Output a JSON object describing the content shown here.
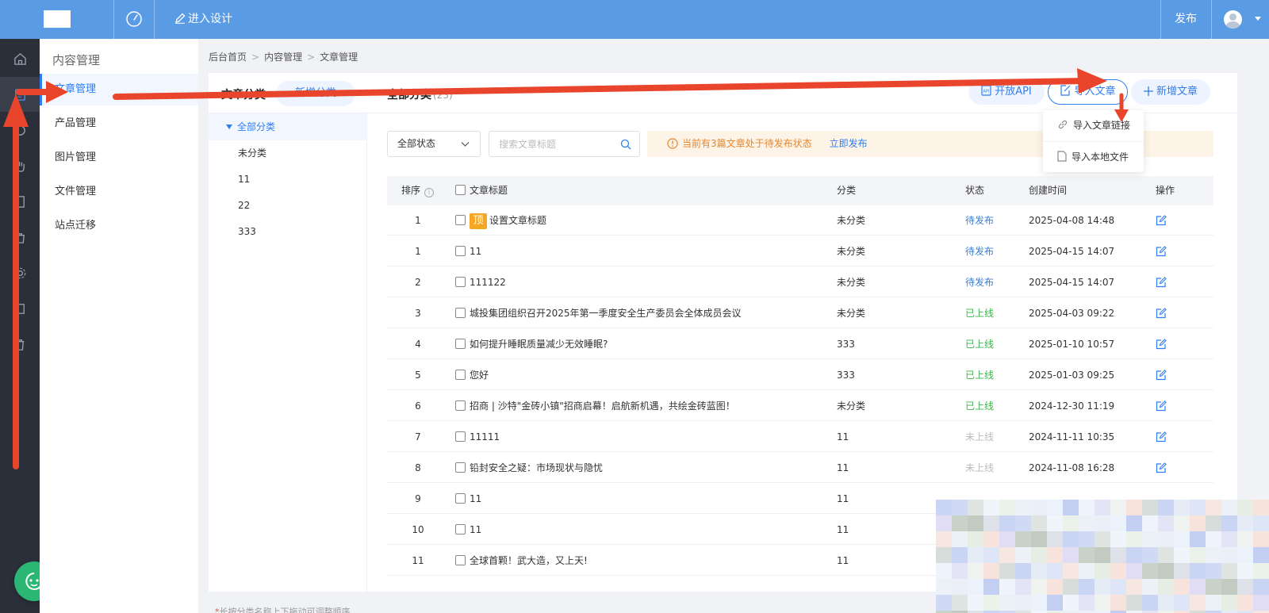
{
  "topbar": {
    "design_label": "进入设计",
    "publish_label": "发布"
  },
  "submenu": {
    "title": "内容管理",
    "items": [
      "文章管理",
      "产品管理",
      "图片管理",
      "文件管理",
      "站点迁移"
    ]
  },
  "breadcrumb": [
    "后台首页",
    "内容管理",
    "文章管理"
  ],
  "category": {
    "heading": "文章分类",
    "add_label": "新增分类",
    "items": [
      "全部分类",
      "未分类",
      "11",
      "22",
      "333"
    ],
    "hint": "长按分类名称上下拖动可调整顺序"
  },
  "main": {
    "heading": "全部分类",
    "count": "(23)",
    "api_label": "开放API",
    "import_label": "导入文章",
    "new_label": "新增文章",
    "import_menu": [
      "导入文章链接",
      "导入本地文件"
    ],
    "status_select": "全部状态",
    "search_placeholder": "搜索文章标题",
    "notice_text": "当前有3篇文章处于待发布状态",
    "notice_link": "立即发布"
  },
  "table": {
    "headers": {
      "sort": "排序",
      "title": "文章标题",
      "category": "分类",
      "status": "状态",
      "created": "创建时间",
      "op": "操作"
    },
    "top_badge": "顶",
    "rows": [
      {
        "sort": "1",
        "title": "设置文章标题",
        "pinned": true,
        "category": "未分类",
        "status": "待发布",
        "status_kind": "pending",
        "created": "2025-04-08 14:48"
      },
      {
        "sort": "1",
        "title": "11",
        "pinned": false,
        "category": "未分类",
        "status": "待发布",
        "status_kind": "pending",
        "created": "2025-04-15 14:07"
      },
      {
        "sort": "2",
        "title": "111122",
        "pinned": false,
        "category": "未分类",
        "status": "待发布",
        "status_kind": "pending",
        "created": "2025-04-15 14:07"
      },
      {
        "sort": "3",
        "title": "城投集团组织召开2025年第一季度安全生产委员会全体成员会议",
        "pinned": false,
        "category": "未分类",
        "status": "已上线",
        "status_kind": "online",
        "created": "2025-04-03 09:22"
      },
      {
        "sort": "4",
        "title": "如何提升睡眠质量减少无效睡眠?",
        "pinned": false,
        "category": "333",
        "status": "已上线",
        "status_kind": "online",
        "created": "2025-01-10 10:57"
      },
      {
        "sort": "5",
        "title": "您好",
        "pinned": false,
        "category": "333",
        "status": "已上线",
        "status_kind": "online",
        "created": "2025-01-03 09:25"
      },
      {
        "sort": "6",
        "title": "招商 | 沙特\"金砖小镇\"招商启幕！启航新机遇，共绘金砖蓝图！",
        "pinned": false,
        "category": "未分类",
        "status": "已上线",
        "status_kind": "online",
        "created": "2024-12-30 11:19"
      },
      {
        "sort": "7",
        "title": "11111",
        "pinned": false,
        "category": "11",
        "status": "未上线",
        "status_kind": "offline",
        "created": "2024-11-11 10:35"
      },
      {
        "sort": "8",
        "title": "铅封安全之疑：市场现状与隐忧",
        "pinned": false,
        "category": "11",
        "status": "未上线",
        "status_kind": "offline",
        "created": "2024-11-08 16:28"
      },
      {
        "sort": "9",
        "title": "11",
        "pinned": false,
        "category": "11",
        "status": "",
        "status_kind": "offline",
        "created": ""
      },
      {
        "sort": "10",
        "title": "11",
        "pinned": false,
        "category": "11",
        "status": "",
        "status_kind": "offline",
        "created": ""
      },
      {
        "sort": "11",
        "title": "全球首颗！武大造，又上天!",
        "pinned": false,
        "category": "11",
        "status": "",
        "status_kind": "offline",
        "created": ""
      }
    ]
  },
  "colors": {
    "topbar": "#5a9be6",
    "accent": "#2f7ef0",
    "rail": "#2b2f3a",
    "annotation": "#e8452c",
    "pending": "#3b7fd6",
    "online": "#3cb44b",
    "notice": "#e6862e"
  }
}
